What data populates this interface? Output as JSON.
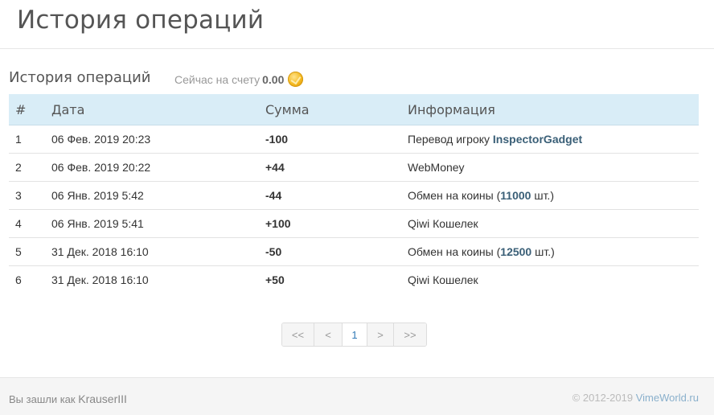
{
  "header": {
    "title": "История операций"
  },
  "section": {
    "title": "История операций",
    "balance_label": "Сейчас на счету",
    "balance_value": "0.00"
  },
  "table": {
    "columns": [
      "#",
      "Дата",
      "Сумма",
      "Информация"
    ],
    "rows": [
      {
        "num": "1",
        "date": "06 Фев. 2019 20:23",
        "amount": "-100",
        "info_text": "Перевод игроку ",
        "info_highlight": "InspectorGadget",
        "info_suffix": ""
      },
      {
        "num": "2",
        "date": "06 Фев. 2019 20:22",
        "amount": "+44",
        "info_text": "WebMoney",
        "info_highlight": "",
        "info_suffix": ""
      },
      {
        "num": "3",
        "date": "06 Янв. 2019 5:42",
        "amount": "-44",
        "info_text": "Обмен на коины (",
        "info_highlight": "11000",
        "info_suffix": " шт.)"
      },
      {
        "num": "4",
        "date": "06 Янв. 2019 5:41",
        "amount": "+100",
        "info_text": "Qiwi Кошелек",
        "info_highlight": "",
        "info_suffix": ""
      },
      {
        "num": "5",
        "date": "31 Дек. 2018 16:10",
        "amount": "-50",
        "info_text": "Обмен на коины (",
        "info_highlight": "12500",
        "info_suffix": " шт.)"
      },
      {
        "num": "6",
        "date": "31 Дек. 2018 16:10",
        "amount": "+50",
        "info_text": "Qiwi Кошелек",
        "info_highlight": "",
        "info_suffix": ""
      }
    ]
  },
  "pagination": {
    "first": "<<",
    "prev": "<",
    "current": "1",
    "next": ">",
    "last": ">>"
  },
  "footer": {
    "logged_in_label": "Вы зашли как",
    "username": "KrauserIII",
    "copyright": "© 2012-2019",
    "site": "VimeWorld.ru"
  },
  "icons": {
    "balance": "coin-icon"
  },
  "colors": {
    "negative": "#a94442",
    "positive": "#3c763d",
    "table_header": "#d9edf7",
    "link": "#3a5f77"
  }
}
